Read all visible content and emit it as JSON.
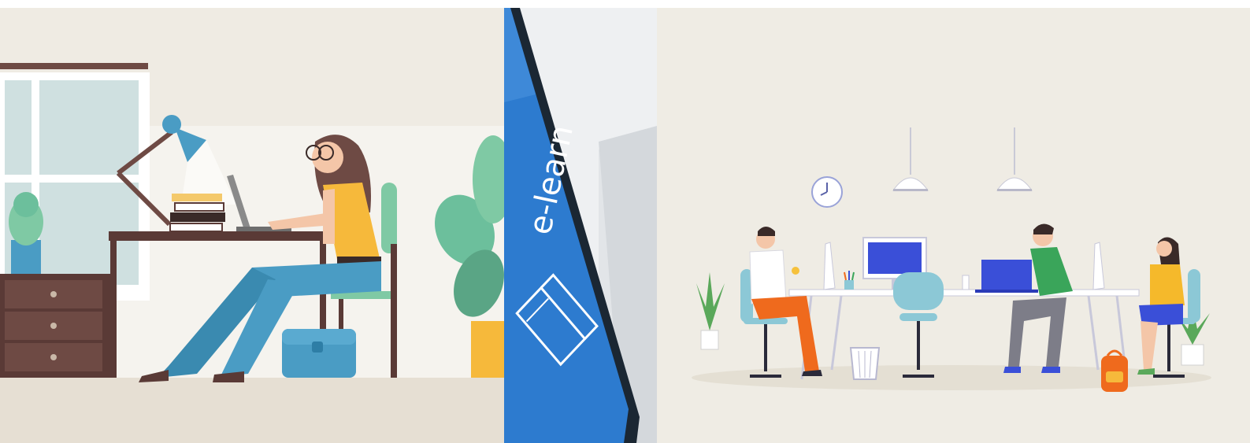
{
  "collage": {
    "panels": [
      {
        "id": "left",
        "subject": "illustration-woman-working-on-laptop-at-desk",
        "colors": {
          "background": "#efebe3",
          "floor": "#e6dfd3",
          "window": "#cfe0e0",
          "desk": "#5a3a36",
          "shirt": "#f6b93b",
          "pants": "#4a9cc4",
          "plant": "#6cbf9c"
        }
      },
      {
        "id": "middle",
        "subject": "photo-keyboard-key-e-learning",
        "key_label": "e-learn",
        "key_icon": "open-book-icon",
        "colors": {
          "key": "#2d7bcf",
          "keyboard": "#eef0f2",
          "shadow": "#1b2733"
        }
      },
      {
        "id": "right",
        "subject": "illustration-coworking-office-team",
        "colors": {
          "background": "#efece4",
          "monitor": "#3a4fd8",
          "shirt_orange": "#ef6a1d",
          "shirt_green": "#3aa55a",
          "shirt_yellow": "#f5b92b",
          "chair": "#8cc8d6",
          "plant": "#5aa85a"
        }
      }
    ]
  }
}
